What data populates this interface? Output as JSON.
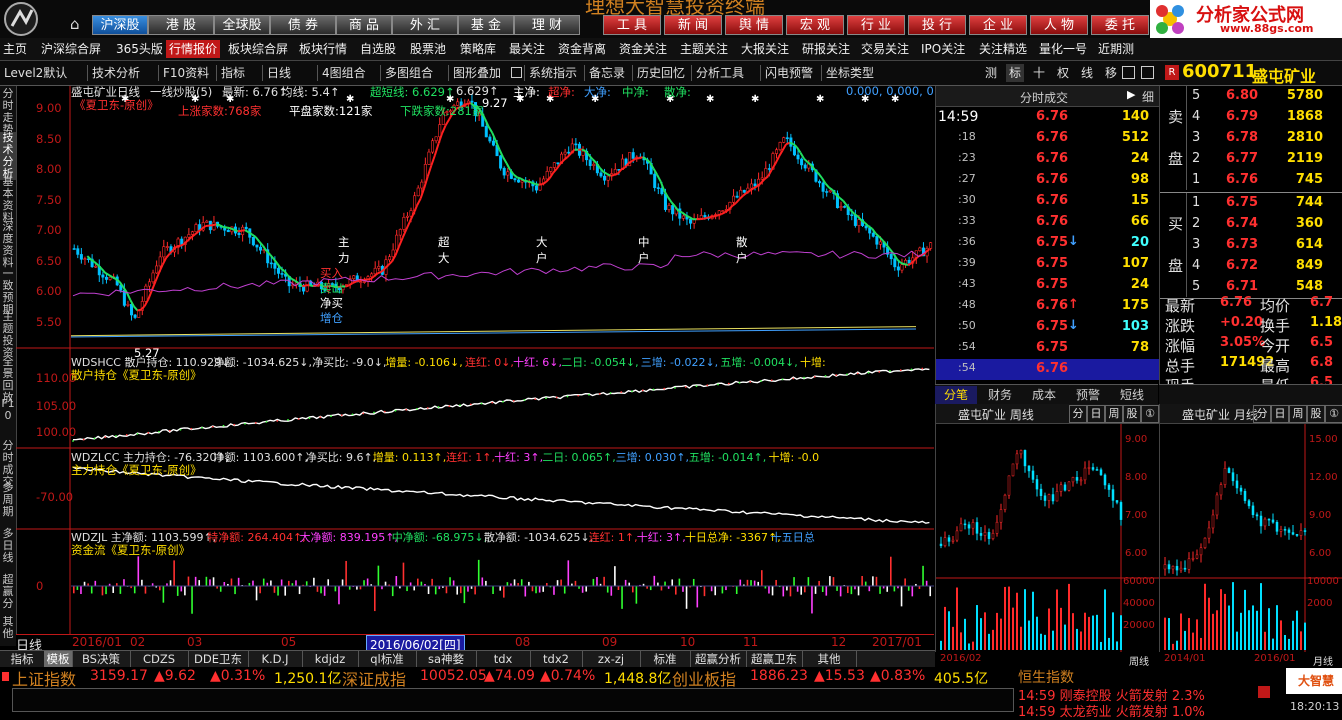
{
  "top": {
    "banner": "理想大智慧投资终端",
    "logo_title": "分析家公式网",
    "logo_url": "www.88gs.com",
    "market_tabs": [
      "沪深股",
      "港 股",
      "全球股",
      "债 券",
      "商 品",
      "外 汇",
      "基 金",
      "理 财"
    ],
    "func_tabs": [
      "工 具",
      "新 闻",
      "舆 情",
      "宏 观",
      "行 业",
      "投 行",
      "企 业",
      "人 物",
      "委 托"
    ]
  },
  "nav": [
    "主页",
    "沪深综合屏",
    "365头版",
    "行情报价",
    "板块综合屏",
    "板块行情",
    "自选股",
    "股票池",
    "策略库",
    "最关注",
    "资金背离",
    "资金关注",
    "主题关注",
    "大报关注",
    "研报关注",
    "交易关注",
    "IPO关注",
    "关注精选",
    "量化一号",
    "近期测"
  ],
  "toolbar": {
    "items": [
      "Level2默认",
      "技术分析",
      "F10资料",
      "指标",
      "日线",
      "4图组合",
      "多图组合",
      "图形叠加",
      "系统指示",
      "备忘录",
      "历史回忆",
      "分析工具",
      "闪电预警",
      "坐标类型"
    ],
    "right_icons": [
      "测",
      "标",
      "十",
      "权",
      "线",
      "移"
    ]
  },
  "stock": {
    "badge": "R",
    "code": "600711",
    "name": "盛屯矿业"
  },
  "left_tabs": [
    "分时走势",
    "技术分析",
    "基本资料",
    "深度资料",
    "一致预期",
    "主题投资",
    "全景回放",
    "F10",
    "分时成交",
    "多周期",
    "多日线",
    "超赢分",
    "其他"
  ],
  "chart_text": {
    "main_title": "盛屯矿业日线",
    "main_ind": "一线炒股(5)",
    "main_vals": [
      "最新: 6.76↑",
      "均线: 5.4↑",
      "超短线: 6.629↑",
      "6.629↑",
      "主净:",
      "超净:",
      "大净:",
      "中净:",
      "散净:",
      "0.000, 0.000, 0."
    ],
    "author1": "《夏卫东-原创》",
    "up_count": "上涨家数:768家",
    "flat_count": "平盘家数:121家",
    "down_count": "下跌家数:281家",
    "hi_label": "9.27",
    "lo_label": "5.27",
    "vlabels": [
      [
        "主",
        "力"
      ],
      [
        "超",
        "大"
      ],
      [
        "大",
        "户"
      ],
      [
        "中",
        "户"
      ],
      [
        "散",
        "户"
      ]
    ],
    "buysell": [
      "买入",
      "卖出",
      "净买",
      "增仓"
    ],
    "p1_line": [
      "WDSHCC 散户持仓: 110.929↓,",
      "净额: -1034.625↓,",
      "净买比: -9.0↓,",
      "增量: -0.106↓,",
      "连红: 0↓,",
      "十红: 6↓,",
      "二日: -0.054↓,",
      "三增: -0.022↓,",
      "五增: -0.004↓,",
      "十增:"
    ],
    "p1_name": "散户持仓《夏卫东-原创》",
    "p2_line": [
      "WDZLCC 主力持仓: -76.320↑,",
      "净额: 1103.600↑,",
      "净买比: 9.6↑,",
      "增量: 0.113↑,",
      "连红: 1↑,",
      "十红: 3↑,",
      "二日: 0.065↑,",
      "三增: 0.030↑,",
      "五增: -0.014↑,",
      "十增: -0.0"
    ],
    "p2_name": "主力持仓《夏卫东-原创》",
    "p3_line": [
      "WDZJL 主净额: 1103.599↑,",
      "特净额: 264.404↑,",
      "大净额: 839.195↑,",
      "中净额: -68.975↓,",
      "散净额: -1034.625↓,",
      "连红: 1↑,",
      "十红: 3↑,",
      "十日总净: -3367↑,",
      "十五日总"
    ],
    "p3_name": "资金流《夏卫东-原创》",
    "date_axis": [
      "2016/01",
      "02",
      "03",
      "05",
      "07",
      "08",
      "09",
      "10",
      "11",
      "12",
      "2017/01"
    ],
    "cursor_date": "2016/06/02[四]",
    "period": "日线"
  },
  "main_yaxis": [
    "9.00",
    "8.50",
    "8.00",
    "7.50",
    "7.00",
    "6.50",
    "6.00",
    "5.50"
  ],
  "p1_yaxis": [
    "110.00",
    "105.00",
    "100.00"
  ],
  "p2_yaxis": [
    "-70.00"
  ],
  "p3_yaxis": [
    "0"
  ],
  "tick": {
    "header": "分时成交",
    "fine": "细",
    "rows": [
      [
        "14:59",
        "6.76",
        "140",
        ""
      ],
      [
        ":18",
        "6.76",
        "512",
        ""
      ],
      [
        ":23",
        "6.76",
        "24",
        ""
      ],
      [
        ":27",
        "6.76",
        "98",
        ""
      ],
      [
        ":30",
        "6.76",
        "15",
        ""
      ],
      [
        ":33",
        "6.76",
        "66",
        ""
      ],
      [
        ":36",
        "6.75",
        "20",
        "down"
      ],
      [
        ":39",
        "6.75",
        "107",
        ""
      ],
      [
        ":43",
        "6.75",
        "24",
        ""
      ],
      [
        ":48",
        "6.76",
        "175",
        "up"
      ],
      [
        ":50",
        "6.75",
        "103",
        "down"
      ],
      [
        ":54",
        "6.75",
        "78",
        ""
      ],
      [
        ":54",
        "6.76",
        "",
        ""
      ]
    ]
  },
  "quote": {
    "sell_label": [
      "卖",
      "盘"
    ],
    "buy_label": [
      "买",
      "盘"
    ],
    "sells": [
      [
        "5",
        "6.80",
        "5780"
      ],
      [
        "4",
        "6.79",
        "1868"
      ],
      [
        "3",
        "6.78",
        "2810"
      ],
      [
        "2",
        "6.77",
        "2119"
      ],
      [
        "1",
        "6.76",
        "745"
      ]
    ],
    "buys": [
      [
        "1",
        "6.75",
        "744"
      ],
      [
        "2",
        "6.74",
        "360"
      ],
      [
        "3",
        "6.73",
        "614"
      ],
      [
        "4",
        "6.72",
        "849"
      ],
      [
        "5",
        "6.71",
        "548"
      ]
    ],
    "stats": [
      [
        "最新",
        "6.76",
        "均价",
        "6.7"
      ],
      [
        "涨跌",
        "+0.20",
        "换手",
        "1.18"
      ],
      [
        "涨幅",
        "3.05%",
        "今开",
        "6.5"
      ],
      [
        "总手",
        "171492",
        "最高",
        "6.8"
      ],
      [
        "现手",
        "",
        "最低",
        "6.5"
      ]
    ]
  },
  "subtabs": [
    "分笔",
    "财务",
    "成本",
    "预警",
    "短线"
  ],
  "mini": {
    "week_title": "盛屯矿业 周线",
    "month_title": "盛屯矿业 月线",
    "btns": [
      "分",
      "日",
      "周",
      "股",
      "①"
    ],
    "week_axis": [
      "9.00",
      "8.00",
      "7.00",
      "6.00"
    ],
    "month_axis": [
      "15.00",
      "12.00",
      "9.00",
      "6.00"
    ],
    "week_vol": [
      "60000",
      "40000",
      "20000"
    ],
    "month_vol": [
      "10000",
      "2000"
    ],
    "week_date": [
      "2016/02",
      "周线"
    ],
    "month_date": [
      "2014/01",
      "2016/01",
      "月线"
    ]
  },
  "bottom_tabs": [
    "指标",
    "模板",
    "BS决策",
    "CDZS",
    "DDE卫东",
    "K.D.J",
    "kdjdz",
    "ql标准",
    "sa神婺",
    "tdx",
    "tdx2",
    "zx-zj",
    "标准",
    "超赢分析",
    "超赢卫东",
    "其他"
  ],
  "indices": [
    {
      "name": "上证指数",
      "val": "3159.17",
      "chg": "▲9.62",
      "pct": "▲0.31%",
      "amt": "1,250.1亿"
    },
    {
      "name": "深证成指",
      "val": "10052.05",
      "chg": "▲74.09",
      "pct": "▲0.74%",
      "amt": "1,448.8亿"
    },
    {
      "name": "创业板指",
      "val": "1886.23",
      "chg": "▲15.53",
      "pct": "▲0.83%",
      "amt": "405.5亿"
    }
  ],
  "news": {
    "title": "恒生指数",
    "lines": [
      "14:59 刚泰控股 火箭发射 2.3%",
      "14:59 太龙药业 火箭发射 1.0%"
    ]
  },
  "clock": "18:20:13",
  "brand": "大智慧"
}
